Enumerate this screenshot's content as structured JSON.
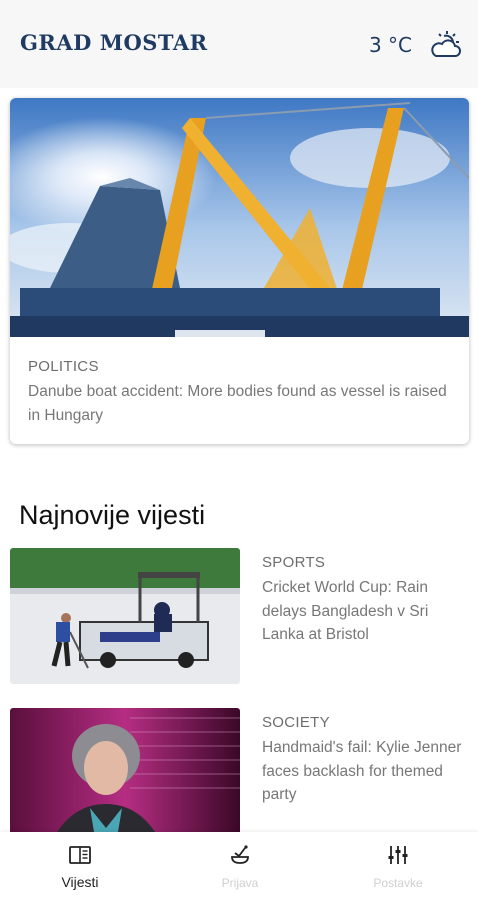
{
  "header": {
    "brand": "GRAD MOSTAR",
    "temperature": "3 °C",
    "weather_icon": "partly-cloudy-icon"
  },
  "featured": {
    "category": "POLITICS",
    "title": "Danube boat accident: More bodies found as vessel is raised in Hungary"
  },
  "latest": {
    "section_title": "Najnovije vijesti",
    "items": [
      {
        "category": "SPORTS",
        "title": "Cricket World Cup: Rain delays Bangladesh v Sri Lanka at Bristol"
      },
      {
        "category": "SOCIETY",
        "title": "Handmaid's fail: Kylie Jenner faces backlash for themed party"
      }
    ]
  },
  "bottom_nav": {
    "items": [
      {
        "label": "Vijesti",
        "icon": "newspaper-icon",
        "active": true
      },
      {
        "label": "Prijava",
        "icon": "report-icon",
        "active": false
      },
      {
        "label": "Postavke",
        "icon": "sliders-icon",
        "active": false
      }
    ]
  },
  "colors": {
    "brand": "#1f3b63",
    "inactive_nav": "#cfcfcf",
    "meta_text": "#777777"
  }
}
